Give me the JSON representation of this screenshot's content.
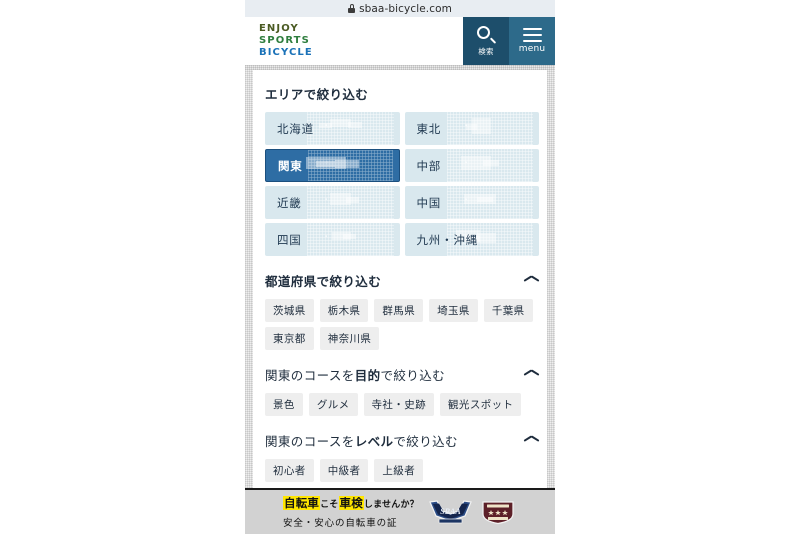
{
  "browser": {
    "url": "sbaa-bicycle.com",
    "lock_icon": "lock-icon"
  },
  "header": {
    "logo": {
      "line1": "ENJOY",
      "line2": "SPORTS",
      "line3": "BICYCLE"
    },
    "search_button": {
      "label": "検索",
      "icon": "magnifier-icon"
    },
    "menu_button": {
      "label": "menu",
      "icon": "hamburger-icon"
    }
  },
  "area_section": {
    "title": "エリアで絞り込む",
    "tiles": [
      {
        "label": "北海道",
        "selected": false
      },
      {
        "label": "東北",
        "selected": false
      },
      {
        "label": "関東",
        "selected": true
      },
      {
        "label": "中部",
        "selected": false
      },
      {
        "label": "近畿",
        "selected": false
      },
      {
        "label": "中国",
        "selected": false
      },
      {
        "label": "四国",
        "selected": false
      },
      {
        "label": "九州・沖縄",
        "selected": false
      }
    ]
  },
  "prefecture_section": {
    "title": "都道府県で絞り込む",
    "collapse_icon": "chevron-up-icon",
    "chips": [
      "茨城県",
      "栃木県",
      "群馬県",
      "埼玉県",
      "千葉県",
      "東京都",
      "神奈川県"
    ]
  },
  "purpose_section": {
    "title_bold_1": "関東のコースを",
    "title_strong": "目的",
    "title_bold_2": "で絞り込む",
    "collapse_icon": "chevron-up-icon",
    "chips": [
      "景色",
      "グルメ",
      "寺社・史跡",
      "観光スポット"
    ]
  },
  "level_section": {
    "title_bold_1": "関東のコースを",
    "title_strong": "レベル",
    "title_bold_2": "で絞り込む",
    "collapse_icon": "chevron-up-icon",
    "chips": [
      "初心者",
      "中級者",
      "上級者"
    ]
  },
  "banner": {
    "line1_part1": "自転車",
    "line1_part2": "こそ",
    "line1_part3": "車検",
    "line1_part4": "しませんか？",
    "line2": "安全・安心の自転車の証",
    "badge1": "sbaa-badge-icon",
    "badge2": "shield-badge-icon"
  },
  "colors": {
    "search_bg": "#1d4e6b",
    "menu_bg": "#2d6a8a",
    "tile_bg": "#d9e8ee",
    "tile_selected_bg": "#2e6da4",
    "chip_bg": "#eeeeee",
    "banner_bg": "#d2d2d2",
    "highlight": "#ffe600"
  }
}
